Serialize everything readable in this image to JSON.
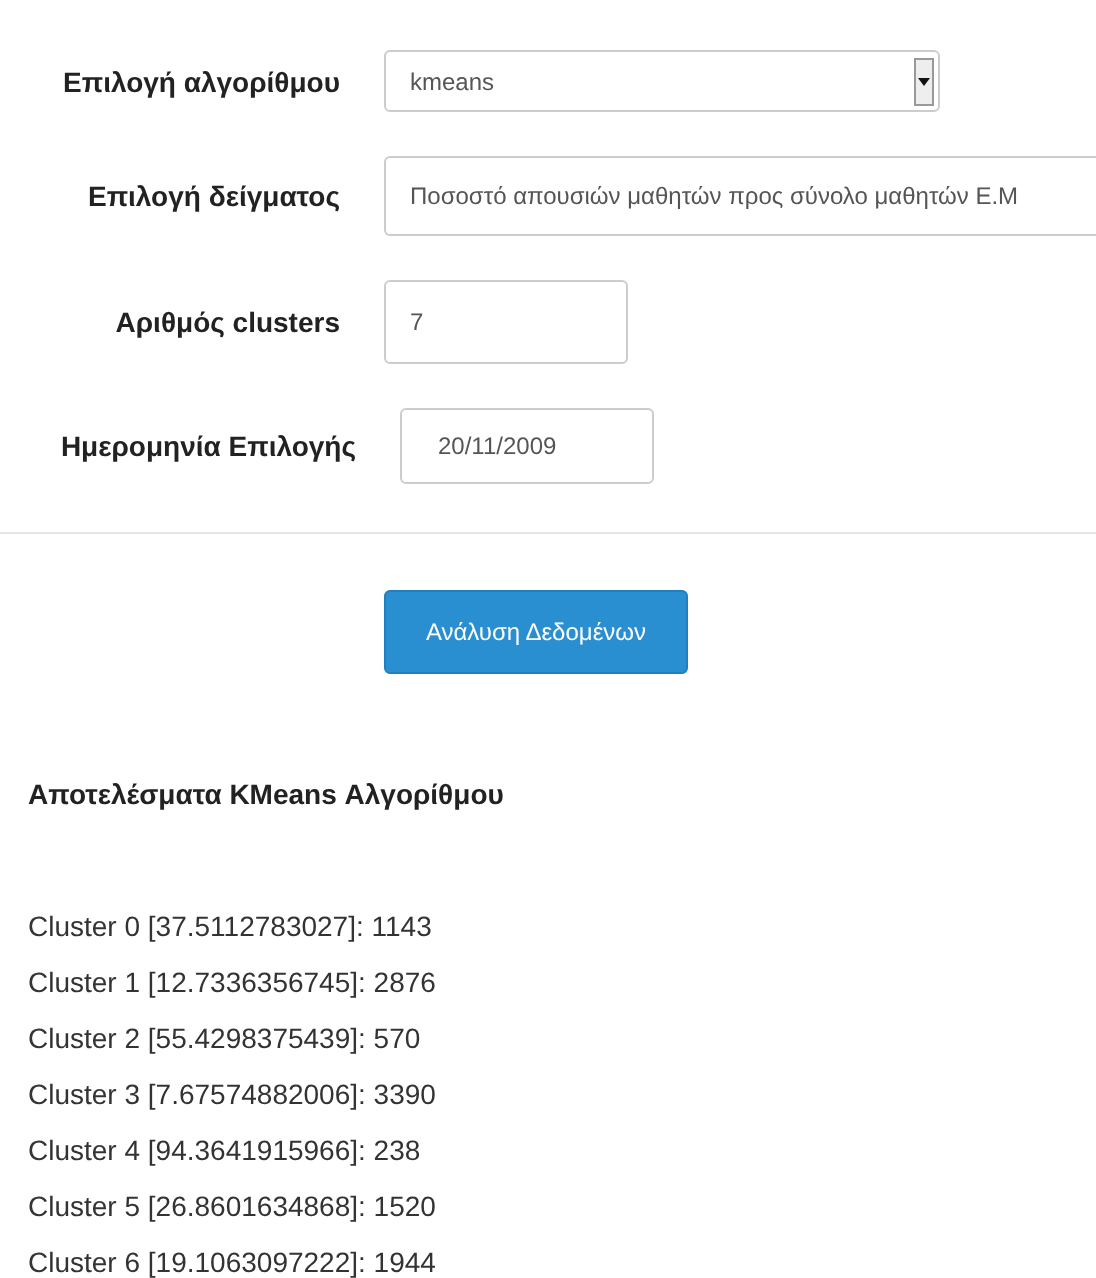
{
  "form": {
    "fields": [
      {
        "label": "Επιλογή αλγορίθμου",
        "kind": "select",
        "value": "kmeans"
      },
      {
        "label": "Επιλογή δείγματος",
        "kind": "wide",
        "value": "Ποσοστό απουσιών μαθητών προς σύνολο μαθητών Ε.Μ"
      },
      {
        "label": "Αριθμός clusters",
        "kind": "text",
        "value": "7"
      },
      {
        "label": "Ημερομηνία Επιλογής",
        "kind": "date",
        "value": "20/11/2009"
      }
    ],
    "submit": "Ανάλυση Δεδομένων"
  },
  "results": {
    "title": "Αποτελέσματα KMeans Αλγορίθμου",
    "lines": [
      "Cluster 0 [37.5112783027]: 1143",
      "Cluster 1 [12.7336356745]: 2876",
      "Cluster 2 [55.4298375439]: 570",
      "Cluster 3 [7.67574882006]: 3390",
      "Cluster 4 [94.3641915966]: 238",
      "Cluster 5 [26.8601634868]: 1520",
      "Cluster 6 [19.1063097222]: 1944"
    ]
  }
}
